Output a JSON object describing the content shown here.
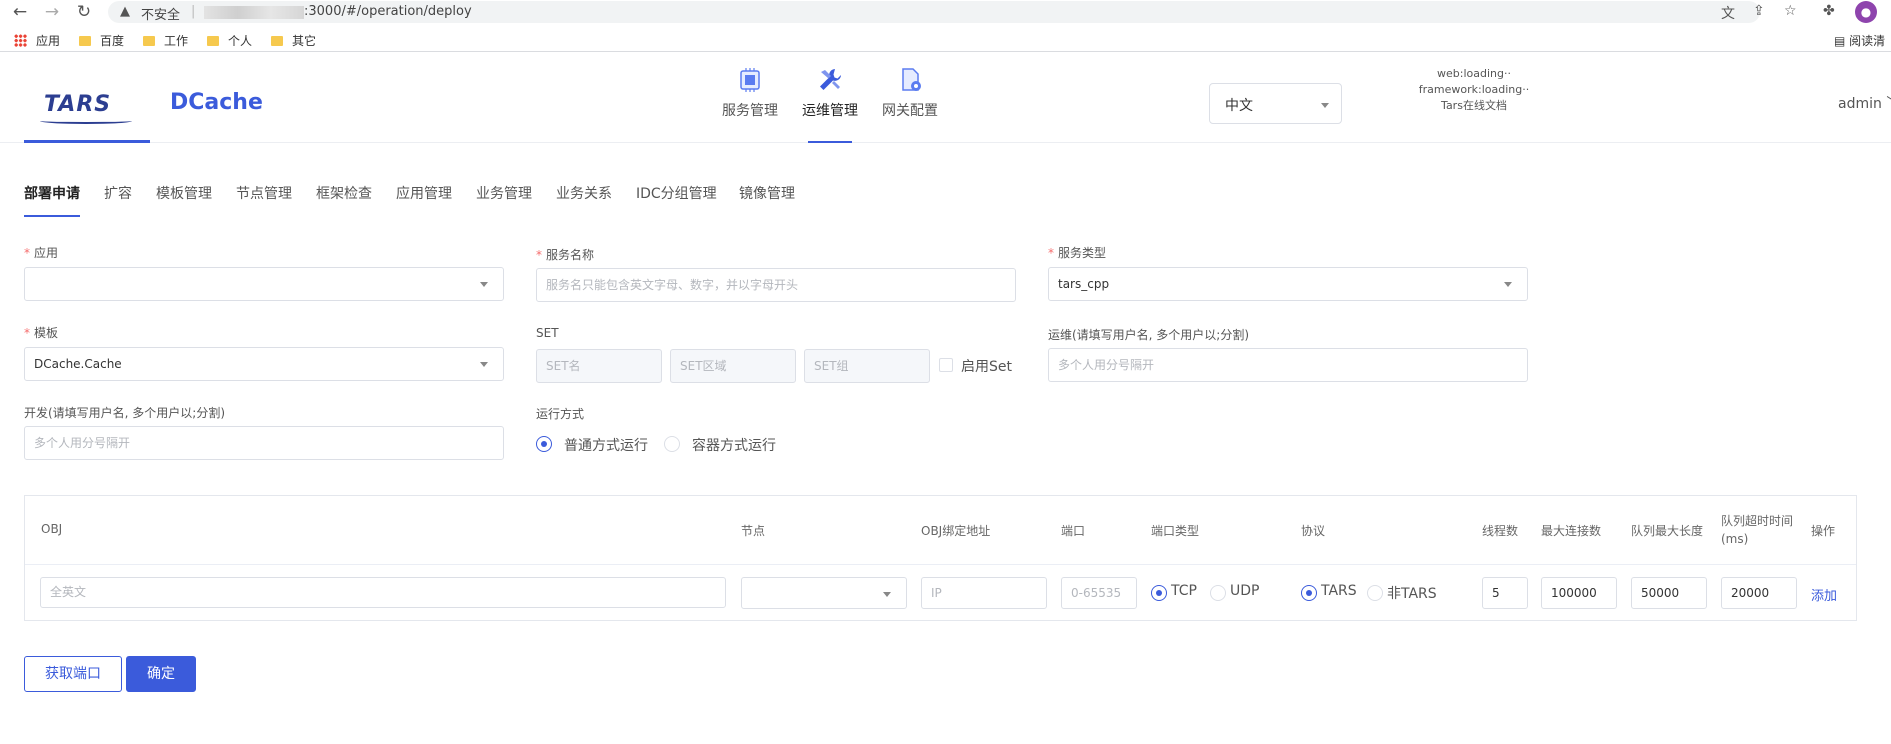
{
  "browser": {
    "insecure_label": "不安全",
    "url": ":3000/#/operation/deploy",
    "bookmarks": [
      "应用",
      "百度",
      "工作",
      "个人",
      "其它"
    ],
    "reader_mode": "阅读清"
  },
  "header": {
    "logo_tars": "TARS",
    "logo_dcache": "DCache",
    "nav": [
      {
        "label": "服务管理",
        "icon": "server-chip-icon"
      },
      {
        "label": "运维管理",
        "icon": "wrench-icon",
        "active": true
      },
      {
        "label": "网关配置",
        "icon": "gateway-doc-icon"
      }
    ],
    "language": "中文",
    "version": {
      "web": "web:loading··",
      "framework": "framework:loading··",
      "docs": "Tars在线文档"
    },
    "user": "admin"
  },
  "subtabs": [
    "部署申请",
    "扩容",
    "模板管理",
    "节点管理",
    "框架检查",
    "应用管理",
    "业务管理",
    "业务关系",
    "IDC分组管理",
    "镜像管理"
  ],
  "form": {
    "application": {
      "label": "应用",
      "value": ""
    },
    "service_name": {
      "label": "服务名称",
      "placeholder": "服务名只能包含英文字母、数字，并以字母开头"
    },
    "service_type": {
      "label": "服务类型",
      "value": "tars_cpp"
    },
    "template": {
      "label": "模板",
      "value": "DCache.Cache"
    },
    "set": {
      "label": "SET",
      "name_placeholder": "SET名",
      "area_placeholder": "SET区域",
      "group_placeholder": "SET组",
      "enable_label": "启用Set"
    },
    "ops": {
      "label": "运维(请填写用户名, 多个用户以;分割)",
      "placeholder": "多个人用分号隔开"
    },
    "dev": {
      "label": "开发(请填写用户名, 多个用户以;分割)",
      "placeholder": "多个人用分号隔开"
    },
    "run_mode": {
      "label": "运行方式",
      "options": [
        "普通方式运行",
        "容器方式运行"
      ],
      "selected": "普通方式运行"
    }
  },
  "obj_table": {
    "headers": {
      "obj": "OBJ",
      "node": "节点",
      "bind": "OBJ绑定地址",
      "port": "端口",
      "port_type": "端口类型",
      "protocol": "协议",
      "threads": "线程数",
      "max_conn": "最大连接数",
      "queue_len": "队列最大长度",
      "queue_timeout": "队列超时时间(ms)",
      "action": "操作"
    },
    "row": {
      "obj_placeholder": "全英文",
      "node_value": "",
      "bind_placeholder": "IP",
      "port_placeholder": "0-65535",
      "port_type_options": [
        "TCP",
        "UDP"
      ],
      "port_type_selected": "TCP",
      "protocol_options": [
        "TARS",
        "非TARS"
      ],
      "protocol_selected": "TARS",
      "threads": "5",
      "max_conn": "100000",
      "queue_len": "50000",
      "queue_timeout": "20000",
      "add_label": "添加"
    }
  },
  "buttons": {
    "get_port": "获取端口",
    "confirm": "确定"
  },
  "colors": {
    "accent": "#3b5bdb",
    "required": "#f56c6c",
    "border": "#dcdfe6"
  }
}
